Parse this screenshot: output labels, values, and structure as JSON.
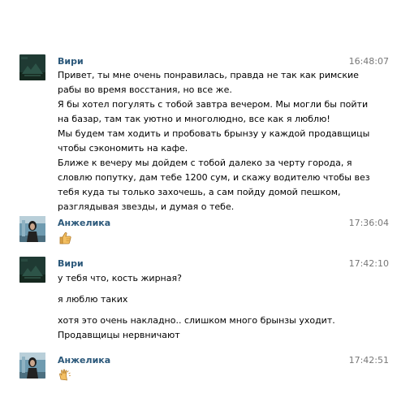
{
  "messages": [
    {
      "author": "Вири",
      "time": "16:48:07",
      "lines": [
        "Привет, ты мне очень понравилась, правда не так как римские",
        "рабы во время восстания, но все же.",
        "Я бы хотел погулять с тобой завтра вечером. Мы могли бы пойти",
        "на базар, там так уютно и многолюдно, все как я люблю!",
        "Мы будем там ходить и пробовать брынзу у каждой продавщицы",
        "чтобы сэкономить на кафе.",
        "Ближе к вечеру мы дойдем с тобой далеко за черту города, я",
        "словлю попутку, дам тебе 1200 сум, и скажу водителю чтобы вез",
        "тебя куда ты только захочешь, а сам пойду домой пешком,",
        "разглядывая звезды, и думая о тебе."
      ]
    },
    {
      "author": "Анжелика",
      "time": "17:36:04",
      "emoji": "thumbs-up-icon"
    },
    {
      "author": "Вири",
      "time": "17:42:10",
      "lines": [
        "у тебя что, кость жирная?",
        "я люблю таких",
        "хотя это очень накладно.. слишком много брынзы уходит.",
        "Продавщицы нервничают"
      ]
    },
    {
      "author": "Анжелика",
      "time": "17:42:51",
      "emoji": "clapping-hands-icon"
    }
  ],
  "colors": {
    "author": "#2b587a",
    "time": "#777777",
    "text": "#000000",
    "background": "#ffffff"
  }
}
